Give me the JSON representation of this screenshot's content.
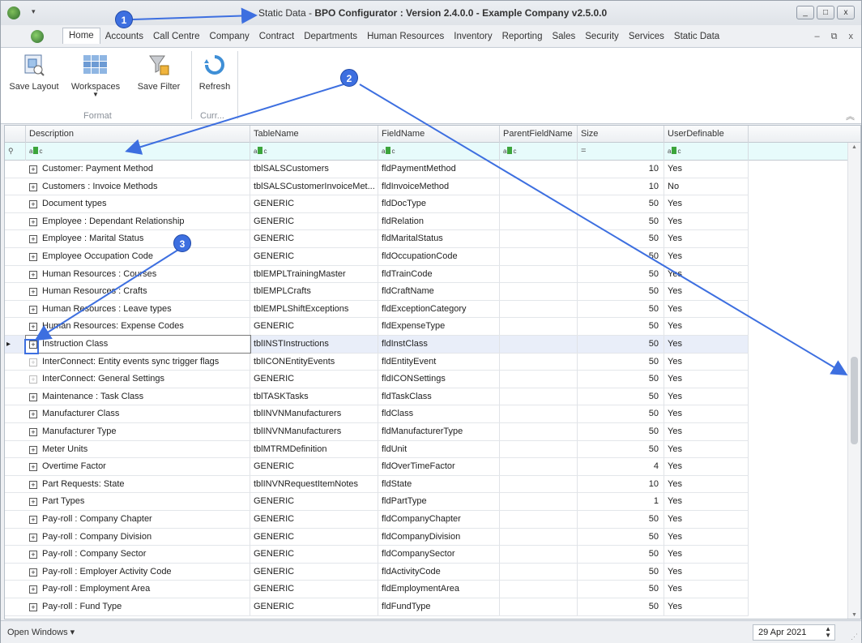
{
  "window": {
    "title_prefix": "Static Data - ",
    "title_bold": "BPO Configurator : Version 2.4.0.0 - Example Company v2.5.0.0",
    "btn_min": "_",
    "btn_max": "□",
    "btn_close": "x"
  },
  "menu": {
    "tabs": [
      "Home",
      "Accounts",
      "Call Centre",
      "Company",
      "Contract",
      "Departments",
      "Human Resources",
      "Inventory",
      "Reporting",
      "Sales",
      "Security",
      "Services",
      "Static Data"
    ],
    "active_tab": "Home",
    "mdi_min": "–",
    "mdi_restore": "⧉",
    "mdi_close": "x"
  },
  "ribbon": {
    "save_layout": "Save Layout",
    "workspaces": "Workspaces",
    "save_filter": "Save Filter",
    "refresh": "Refresh",
    "group_format": "Format",
    "group_curr": "Curr..."
  },
  "grid": {
    "columns": [
      "Description",
      "TableName",
      "FieldName",
      "ParentFieldName",
      "Size",
      "UserDefinable"
    ],
    "filter_equals": "=",
    "rows": [
      {
        "desc": "Customer: Payment Method",
        "table": "tblSALSCustomers",
        "field": "fldPaymentMethod",
        "parent": "",
        "size": "10",
        "user": "Yes"
      },
      {
        "desc": "Customers : Invoice Methods",
        "table": "tblSALSCustomerInvoiceMet...",
        "field": "fldInvoiceMethod",
        "parent": "",
        "size": "10",
        "user": "No"
      },
      {
        "desc": "Document types",
        "table": "GENERIC",
        "field": "fldDocType",
        "parent": "",
        "size": "50",
        "user": "Yes"
      },
      {
        "desc": "Employee : Dependant Relationship",
        "table": "GENERIC",
        "field": "fldRelation",
        "parent": "",
        "size": "50",
        "user": "Yes"
      },
      {
        "desc": "Employee : Marital Status",
        "table": "GENERIC",
        "field": "fldMaritalStatus",
        "parent": "",
        "size": "50",
        "user": "Yes"
      },
      {
        "desc": "Employee Occupation Code",
        "table": "GENERIC",
        "field": "fldOccupationCode",
        "parent": "",
        "size": "50",
        "user": "Yes"
      },
      {
        "desc": "Human Resources : Courses",
        "table": "tblEMPLTrainingMaster",
        "field": "fldTrainCode",
        "parent": "",
        "size": "50",
        "user": "Yes"
      },
      {
        "desc": "Human Resources : Crafts",
        "table": "tblEMPLCrafts",
        "field": "fldCraftName",
        "parent": "",
        "size": "50",
        "user": "Yes"
      },
      {
        "desc": "Human Resources : Leave types",
        "table": "tblEMPLShiftExceptions",
        "field": "fldExceptionCategory",
        "parent": "",
        "size": "50",
        "user": "Yes"
      },
      {
        "desc": "Human Resources: Expense Codes",
        "table": "GENERIC",
        "field": "fldExpenseType",
        "parent": "",
        "size": "50",
        "user": "Yes"
      },
      {
        "desc": "Instruction Class",
        "table": "tblINSTInstructions",
        "field": "fldInstClass",
        "parent": "",
        "size": "50",
        "user": "Yes"
      },
      {
        "desc": "InterConnect: Entity events sync trigger flags",
        "table": "tblICONEntityEvents",
        "field": "fldEntityEvent",
        "parent": "",
        "size": "50",
        "user": "Yes"
      },
      {
        "desc": "InterConnect: General Settings",
        "table": "GENERIC",
        "field": "fldICONSettings",
        "parent": "",
        "size": "50",
        "user": "Yes"
      },
      {
        "desc": "Maintenance : Task Class",
        "table": "tblTASKTasks",
        "field": "fldTaskClass",
        "parent": "",
        "size": "50",
        "user": "Yes"
      },
      {
        "desc": "Manufacturer Class",
        "table": "tblINVNManufacturers",
        "field": "fldClass",
        "parent": "",
        "size": "50",
        "user": "Yes"
      },
      {
        "desc": "Manufacturer Type",
        "table": "tblINVNManufacturers",
        "field": "fldManufacturerType",
        "parent": "",
        "size": "50",
        "user": "Yes"
      },
      {
        "desc": "Meter Units",
        "table": "tblMTRMDefinition",
        "field": "fldUnit",
        "parent": "",
        "size": "50",
        "user": "Yes"
      },
      {
        "desc": "Overtime Factor",
        "table": "GENERIC",
        "field": "fldOverTimeFactor",
        "parent": "",
        "size": "4",
        "user": "Yes"
      },
      {
        "desc": "Part Requests: State",
        "table": "tblINVNRequestItemNotes",
        "field": "fldState",
        "parent": "",
        "size": "10",
        "user": "Yes"
      },
      {
        "desc": "Part Types",
        "table": "GENERIC",
        "field": "fldPartType",
        "parent": "",
        "size": "1",
        "user": "Yes"
      },
      {
        "desc": "Pay-roll : Company Chapter",
        "table": "GENERIC",
        "field": "fldCompanyChapter",
        "parent": "",
        "size": "50",
        "user": "Yes"
      },
      {
        "desc": "Pay-roll : Company Division",
        "table": "GENERIC",
        "field": "fldCompanyDivision",
        "parent": "",
        "size": "50",
        "user": "Yes"
      },
      {
        "desc": "Pay-roll : Company Sector",
        "table": "GENERIC",
        "field": "fldCompanySector",
        "parent": "",
        "size": "50",
        "user": "Yes"
      },
      {
        "desc": "Pay-roll : Employer Activity Code",
        "table": "GENERIC",
        "field": "fldActivityCode",
        "parent": "",
        "size": "50",
        "user": "Yes"
      },
      {
        "desc": "Pay-roll : Employment Area",
        "table": "GENERIC",
        "field": "fldEmploymentArea",
        "parent": "",
        "size": "50",
        "user": "Yes"
      },
      {
        "desc": "Pay-roll : Fund Type",
        "table": "GENERIC",
        "field": "fldFundType",
        "parent": "",
        "size": "50",
        "user": "Yes"
      }
    ]
  },
  "status": {
    "open_windows": "Open Windows ▾",
    "date": "29 Apr 2021"
  },
  "annotations": [
    "1",
    "2",
    "3"
  ],
  "colors": {
    "accent": "#3d6fe0",
    "filter_row": "#e7fbfb",
    "selected_row": "#e9eef9"
  }
}
